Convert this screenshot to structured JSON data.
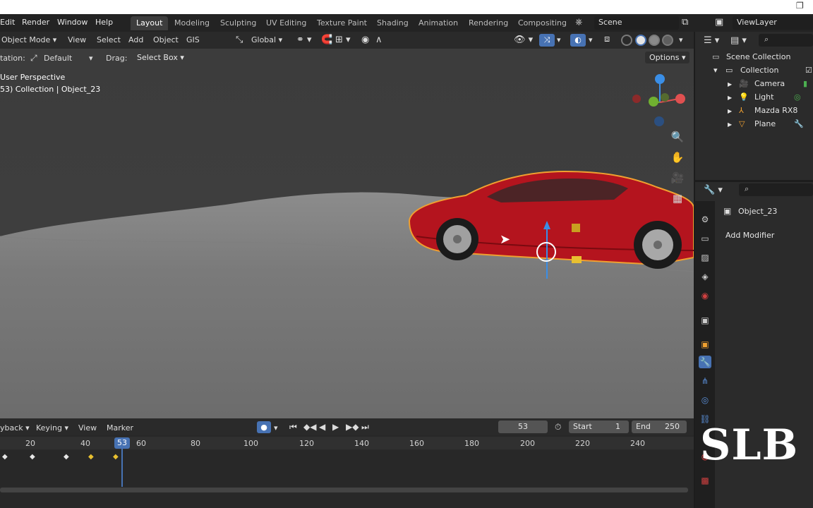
{
  "topbar": {
    "menus": [
      "Edit",
      "Render",
      "Window",
      "Help"
    ],
    "workspaces": [
      "Layout",
      "Modeling",
      "Sculpting",
      "UV Editing",
      "Texture Paint",
      "Shading",
      "Animation",
      "Rendering",
      "Compositing"
    ],
    "active_workspace": "Layout",
    "scene": "Scene",
    "view_layer": "ViewLayer"
  },
  "viewport_header": {
    "mode": "Object Mode",
    "menus": [
      "View",
      "Select",
      "Add",
      "Object",
      "GIS"
    ],
    "orientation_label": "Global"
  },
  "tool_settings": {
    "orientation_prefix": "tation:",
    "orientation_value": "Default",
    "drag_label": "Drag:",
    "drag_value": "Select Box",
    "options_label": "Options"
  },
  "viewport_info": {
    "perspective": "User Perspective",
    "collection_line": "53) Collection | Object_23"
  },
  "outliner": {
    "root": "Scene Collection",
    "collection": "Collection",
    "items": [
      {
        "label": "Camera",
        "icon": "camera-icon"
      },
      {
        "label": "Light",
        "icon": "light-icon"
      },
      {
        "label": "Mazda RX8",
        "icon": "armature-icon"
      },
      {
        "label": "Plane",
        "icon": "mesh-icon"
      }
    ]
  },
  "properties": {
    "object_name": "Object_23",
    "add_modifier": "Add Modifier"
  },
  "timeline": {
    "menus": [
      "yback",
      "Keying",
      "View",
      "Marker"
    ],
    "current_frame": "53",
    "start_label": "Start",
    "start_value": "1",
    "end_label": "End",
    "end_value": "250",
    "ticks": [
      "20",
      "40",
      "53",
      "60",
      "80",
      "100",
      "120",
      "140",
      "160",
      "180",
      "200",
      "220",
      "240"
    ]
  },
  "watermark": "SLB",
  "colors": {
    "accent_blue": "#4772b3",
    "selection_orange": "#f0a030",
    "car_red": "#b4141e"
  }
}
